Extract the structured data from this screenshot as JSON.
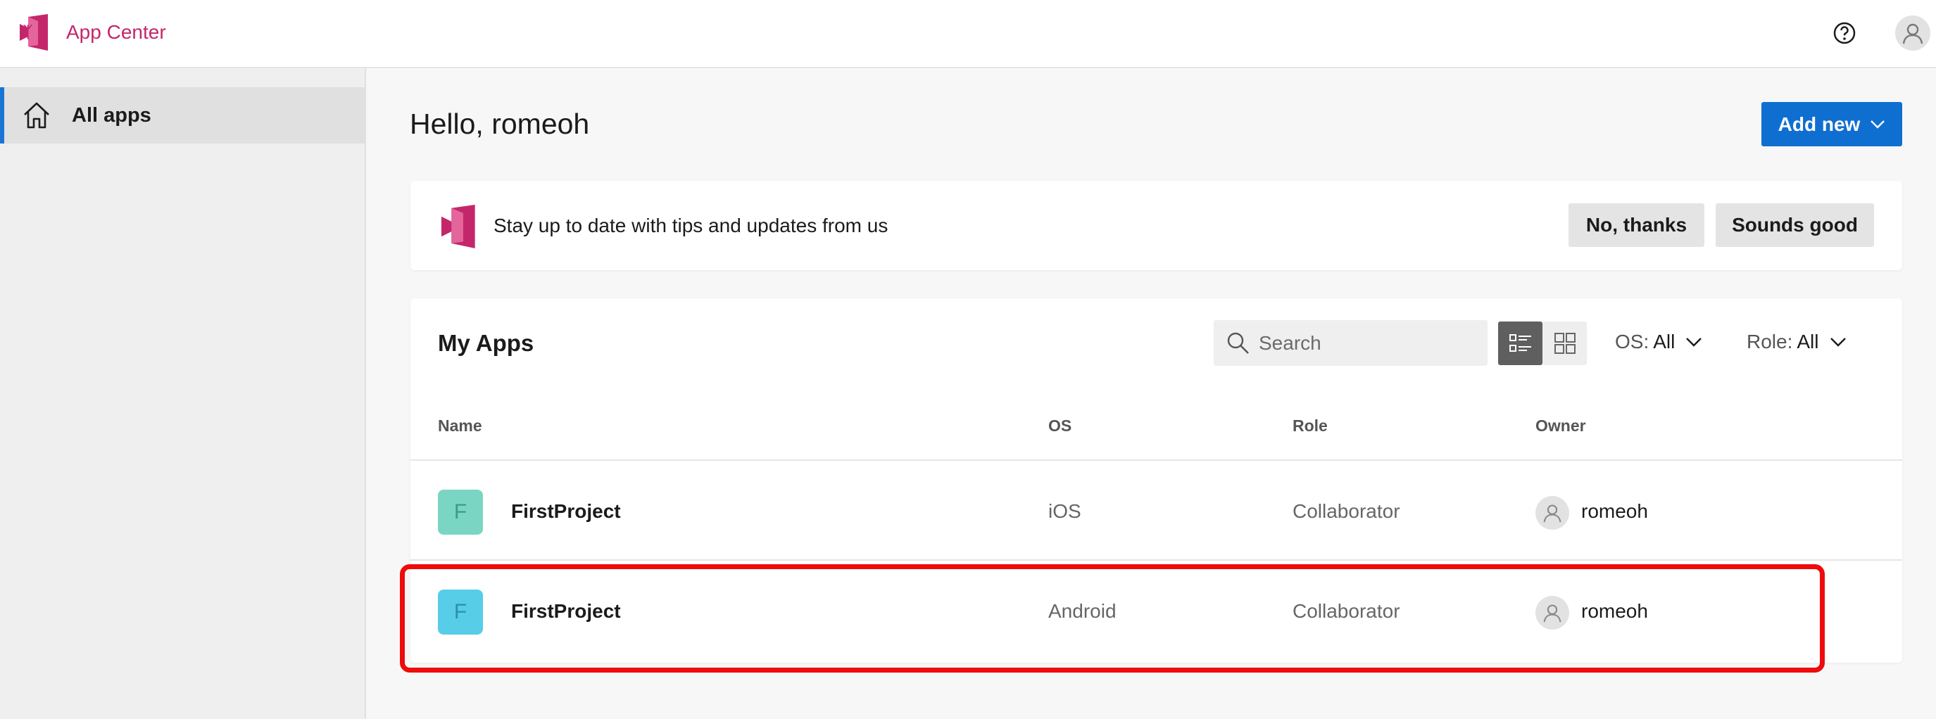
{
  "app": {
    "title": "App Center",
    "brand_color": "#c4266b"
  },
  "header": {
    "help_icon": "help-circle-icon",
    "avatar_icon": "person-icon"
  },
  "sidebar": {
    "items": [
      {
        "label": "All apps",
        "icon": "home-icon",
        "selected": true
      }
    ],
    "accent": "#1a74d4"
  },
  "main": {
    "greeting": "Hello, romeoh",
    "add_new_label": "Add new",
    "tips": {
      "text": "Stay up to date with tips and updates from us",
      "decline_label": "No, thanks",
      "accept_label": "Sounds good"
    },
    "apps": {
      "title": "My Apps",
      "search_placeholder": "Search",
      "filters": {
        "os": {
          "label": "OS:",
          "value": "All"
        },
        "role": {
          "label": "Role:",
          "value": "All"
        }
      },
      "columns": [
        "Name",
        "OS",
        "Role",
        "Owner"
      ],
      "rows": [
        {
          "initial": "F",
          "name": "FirstProject",
          "os": "iOS",
          "role": "Collaborator",
          "owner": "romeoh",
          "icon_color": "#7ad6c3"
        },
        {
          "initial": "F",
          "name": "FirstProject",
          "os": "Android",
          "role": "Collaborator",
          "owner": "romeoh",
          "icon_color": "#57cde8"
        }
      ]
    }
  },
  "annotation": {
    "color": "#ee0b0b",
    "highlighted_row": 1
  }
}
